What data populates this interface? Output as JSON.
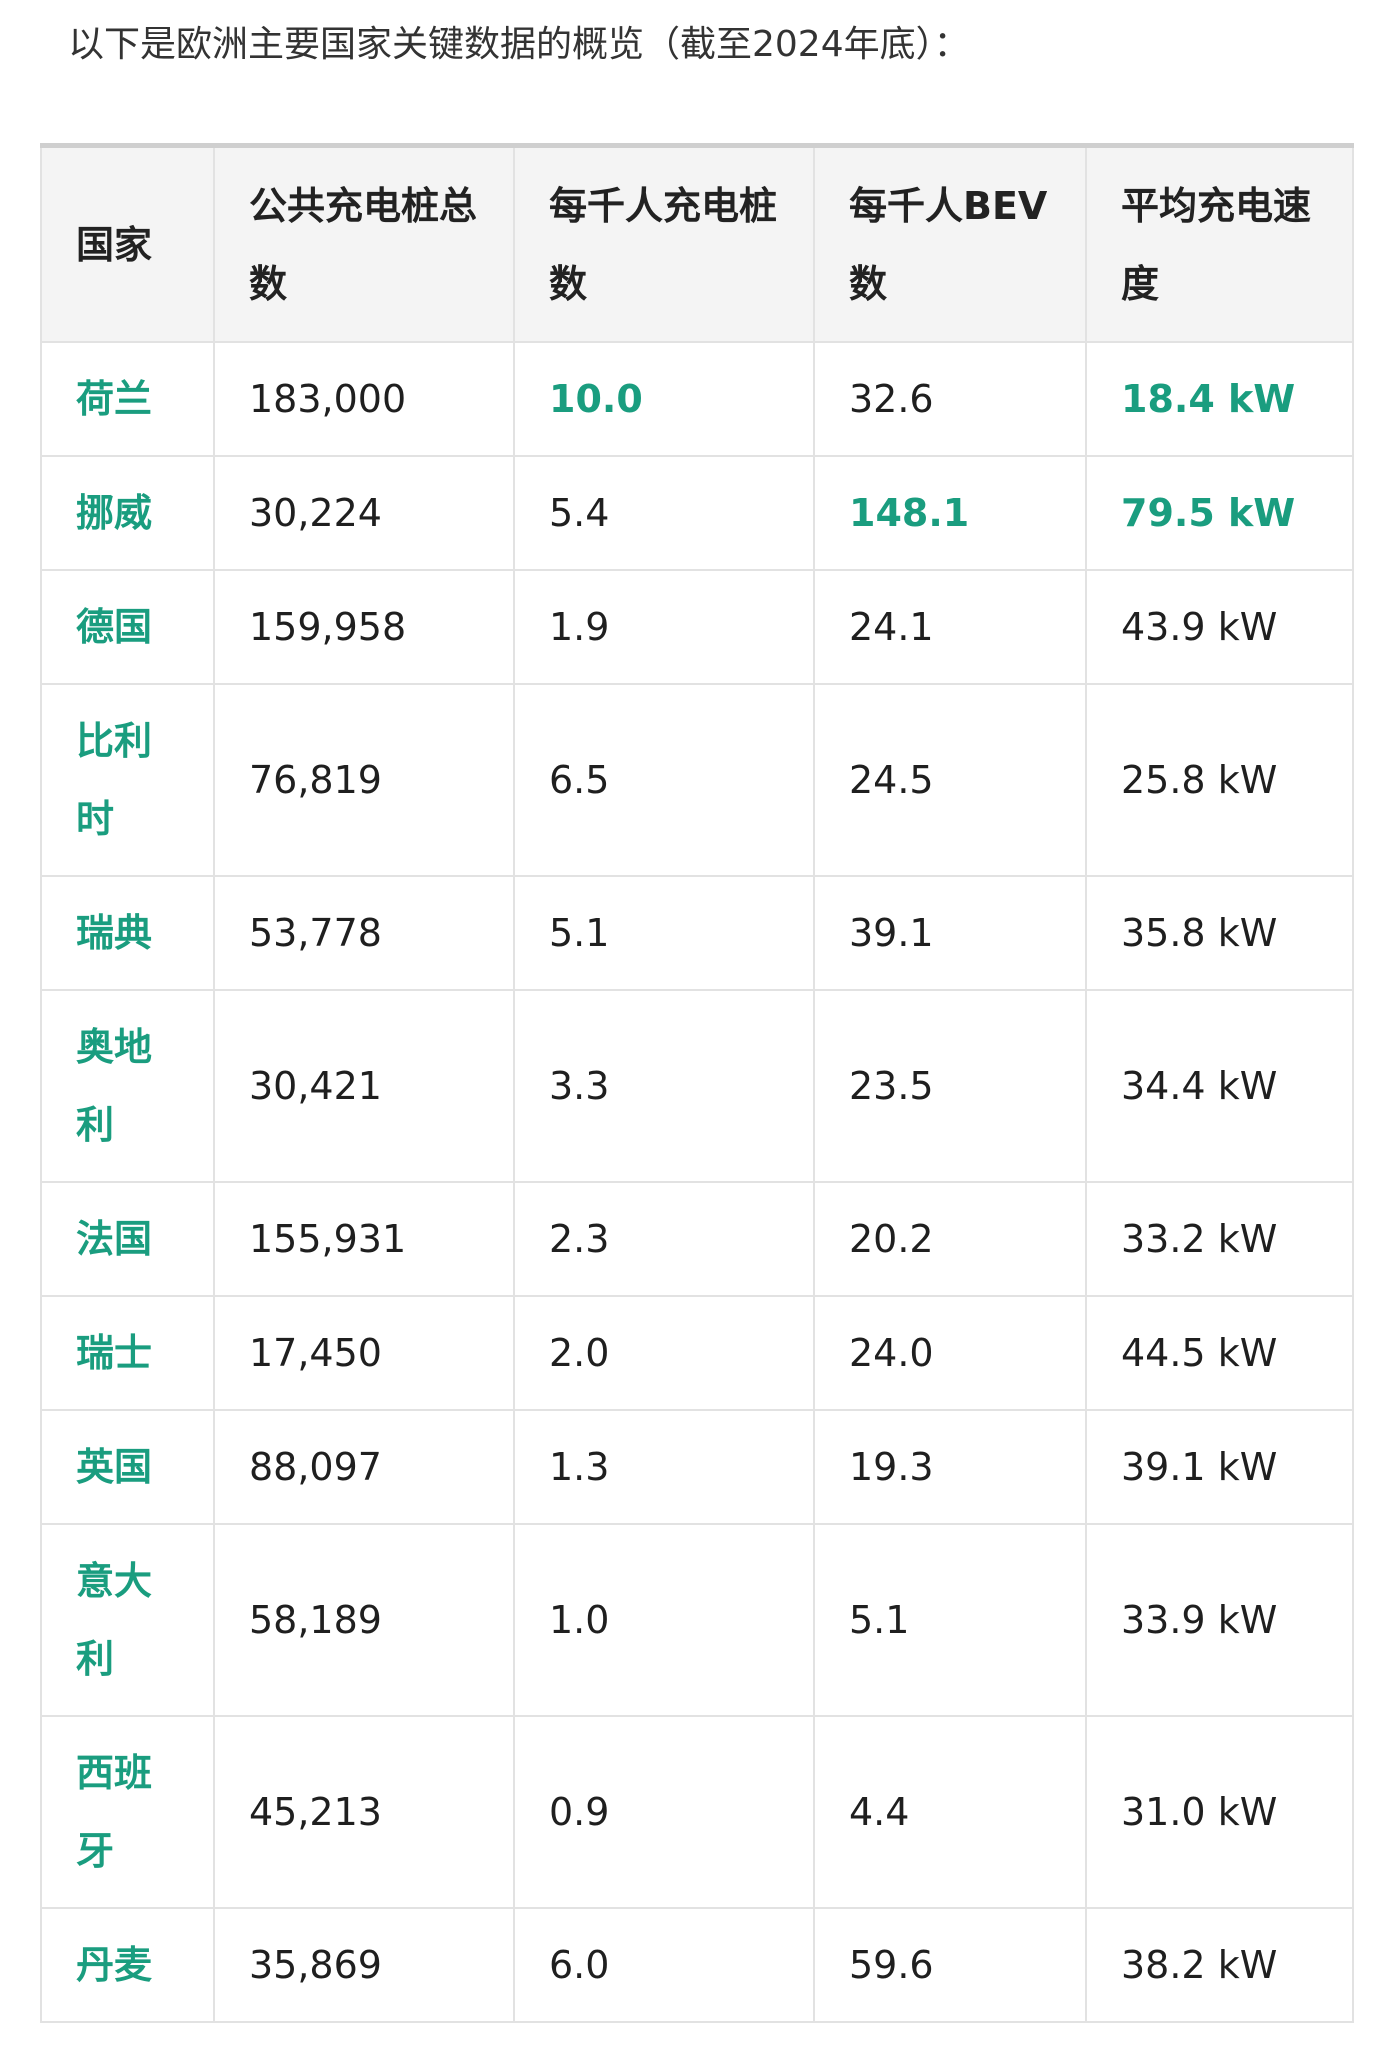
{
  "intro": "以下是欧洲主要国家关键数据的概览（截至2024年底）：",
  "headers": [
    "国家",
    "公共充电桩总数",
    "每千人充电桩数",
    "每千人BEV数",
    "平均充电速度"
  ],
  "rows": [
    {
      "country": "荷兰",
      "total": "183,000",
      "per_thousand_chargers": "10.0",
      "per_thousand_bev": "32.6",
      "avg_speed": "18.4 kW"
    },
    {
      "country": "挪威",
      "total": "30,224",
      "per_thousand_chargers": "5.4",
      "per_thousand_bev": "148.1",
      "avg_speed": "79.5 kW"
    },
    {
      "country": "德国",
      "total": "159,958",
      "per_thousand_chargers": "1.9",
      "per_thousand_bev": "24.1",
      "avg_speed": "43.9 kW"
    },
    {
      "country": "比利时",
      "total": "76,819",
      "per_thousand_chargers": "6.5",
      "per_thousand_bev": "24.5",
      "avg_speed": "25.8 kW"
    },
    {
      "country": "瑞典",
      "total": "53,778",
      "per_thousand_chargers": "5.1",
      "per_thousand_bev": "39.1",
      "avg_speed": "35.8 kW"
    },
    {
      "country": "奥地利",
      "total": "30,421",
      "per_thousand_chargers": "3.3",
      "per_thousand_bev": "23.5",
      "avg_speed": "34.4 kW"
    },
    {
      "country": "法国",
      "total": "155,931",
      "per_thousand_chargers": "2.3",
      "per_thousand_bev": "20.2",
      "avg_speed": "33.2 kW"
    },
    {
      "country": "瑞士",
      "total": "17,450",
      "per_thousand_chargers": "2.0",
      "per_thousand_bev": "24.0",
      "avg_speed": "44.5 kW"
    },
    {
      "country": "英国",
      "total": "88,097",
      "per_thousand_chargers": "1.3",
      "per_thousand_bev": "19.3",
      "avg_speed": "39.1 kW"
    },
    {
      "country": "意大利",
      "total": "58,189",
      "per_thousand_chargers": "1.0",
      "per_thousand_bev": "5.1",
      "avg_speed": "33.9 kW"
    },
    {
      "country": "西班牙",
      "total": "45,213",
      "per_thousand_chargers": "0.9",
      "per_thousand_bev": "4.4",
      "avg_speed": "31.0 kW"
    },
    {
      "country": "丹麦",
      "total": "35,869",
      "per_thousand_chargers": "6.0",
      "per_thousand_bev": "59.6",
      "avg_speed": "38.2 kW"
    }
  ],
  "highlight_color": "#1a9d7f"
}
